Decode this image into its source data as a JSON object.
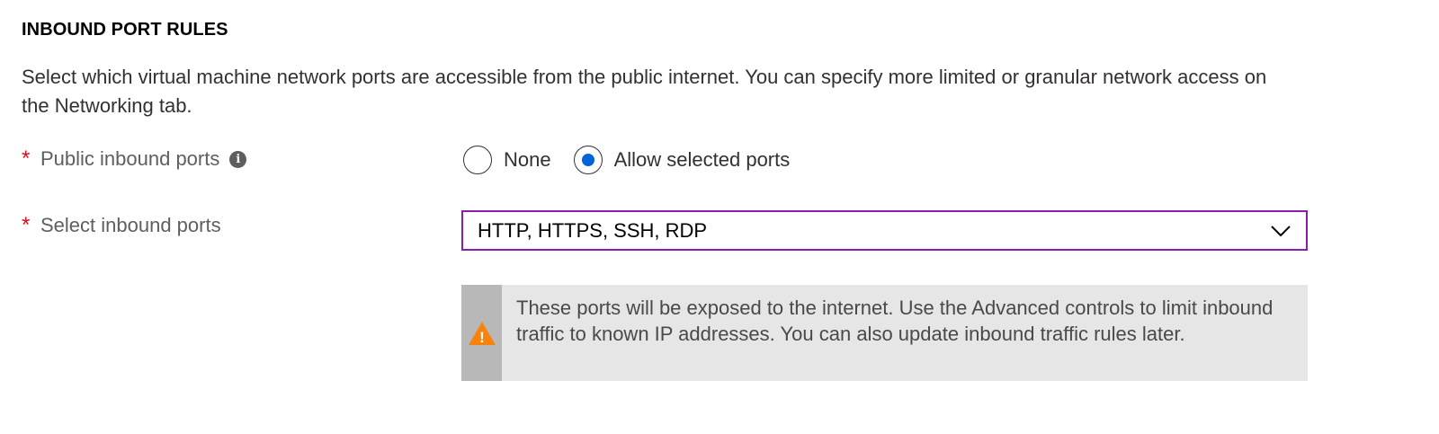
{
  "section": {
    "title": "INBOUND PORT RULES",
    "description": "Select which virtual machine network ports are accessible from the public internet. You can specify more limited or granular network access on the Networking tab."
  },
  "public_inbound_ports": {
    "required_mark": "*",
    "label": "Public inbound ports",
    "info_glyph": "i",
    "options": [
      {
        "label": "None",
        "checked": false
      },
      {
        "label": "Allow selected ports",
        "checked": true
      }
    ]
  },
  "select_inbound_ports": {
    "required_mark": "*",
    "label": "Select inbound ports",
    "value": "HTTP, HTTPS, SSH, RDP"
  },
  "warning": {
    "icon": "warning-triangle-icon",
    "glyph": "!",
    "text": "These ports will be exposed to the internet. Use the Advanced controls to limit inbound traffic to known IP addresses. You can also update inbound traffic rules later."
  },
  "colors": {
    "required": "#e00b1c",
    "radio_selected": "#0063d9",
    "dropdown_border": "#8a1db0",
    "warning_icon": "#f7820c",
    "warning_bg": "#e6e6e6",
    "warning_stripe": "#b8b8b8"
  }
}
